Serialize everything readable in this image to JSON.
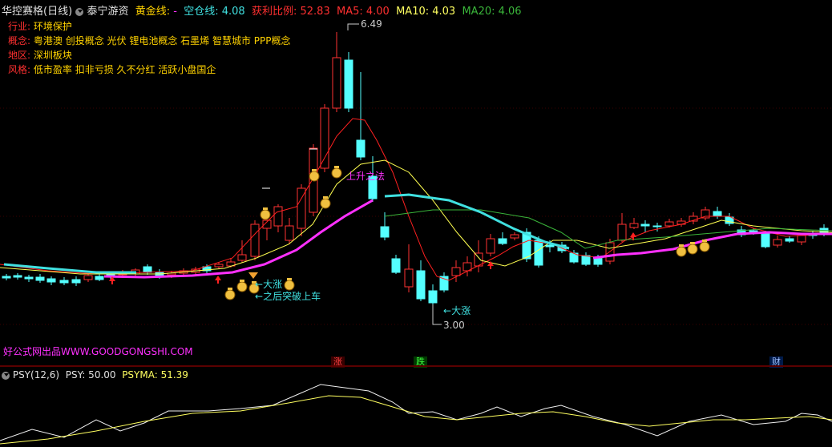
{
  "header": {
    "title": "华控赛格(日线)",
    "indicator_name": "泰宁游资",
    "line1_label": "黄金线:",
    "line1_value": "-",
    "line2_label": "空仓线:",
    "line2_value": "4.08",
    "profit_label": "获利比例:",
    "profit_value": "52.83",
    "ma5": "MA5: 4.00",
    "ma10": "MA10: 4.03",
    "ma20": "MA20: 4.06"
  },
  "info": {
    "industry_key": "行业:",
    "industry_val": "环境保护",
    "concept_key": "概念:",
    "concept_val": "粤港澳 创投概念 光伏 锂电池概念 石墨烯 智慧城市 PPP概念",
    "region_key": "地区:",
    "region_val": "深圳板块",
    "style_key": "风格:",
    "style_val": "低市盈率 扣非亏损 久不分红 活跃小盘国企"
  },
  "annotations": {
    "high": "6.49",
    "low": "3.00",
    "rise_label": "上升之法",
    "big_rise_1": "大涨",
    "breakout": "之后突破上车",
    "big_rise_2": "大涨",
    "watermark": "好公式网出品WWW.GOODGONGSHI.COM"
  },
  "badges": {
    "up": "涨",
    "down": "跌",
    "fin": "财"
  },
  "sub": {
    "title": "PSY(12,6)",
    "psy": "PSY: 50.00",
    "psyma": "PSYMA: 51.39"
  },
  "colors": {
    "up": "#ff3232",
    "down": "#54ffff",
    "ma5": "#ffffff",
    "ma10": "#ffff00",
    "ma20": "#ff00ff",
    "red_line": "#ff2020",
    "yellow_line": "#ffff50",
    "green_line": "#3ab53a",
    "cyan_line": "#40e0e0",
    "magenta_line": "#ff30ff"
  }
}
